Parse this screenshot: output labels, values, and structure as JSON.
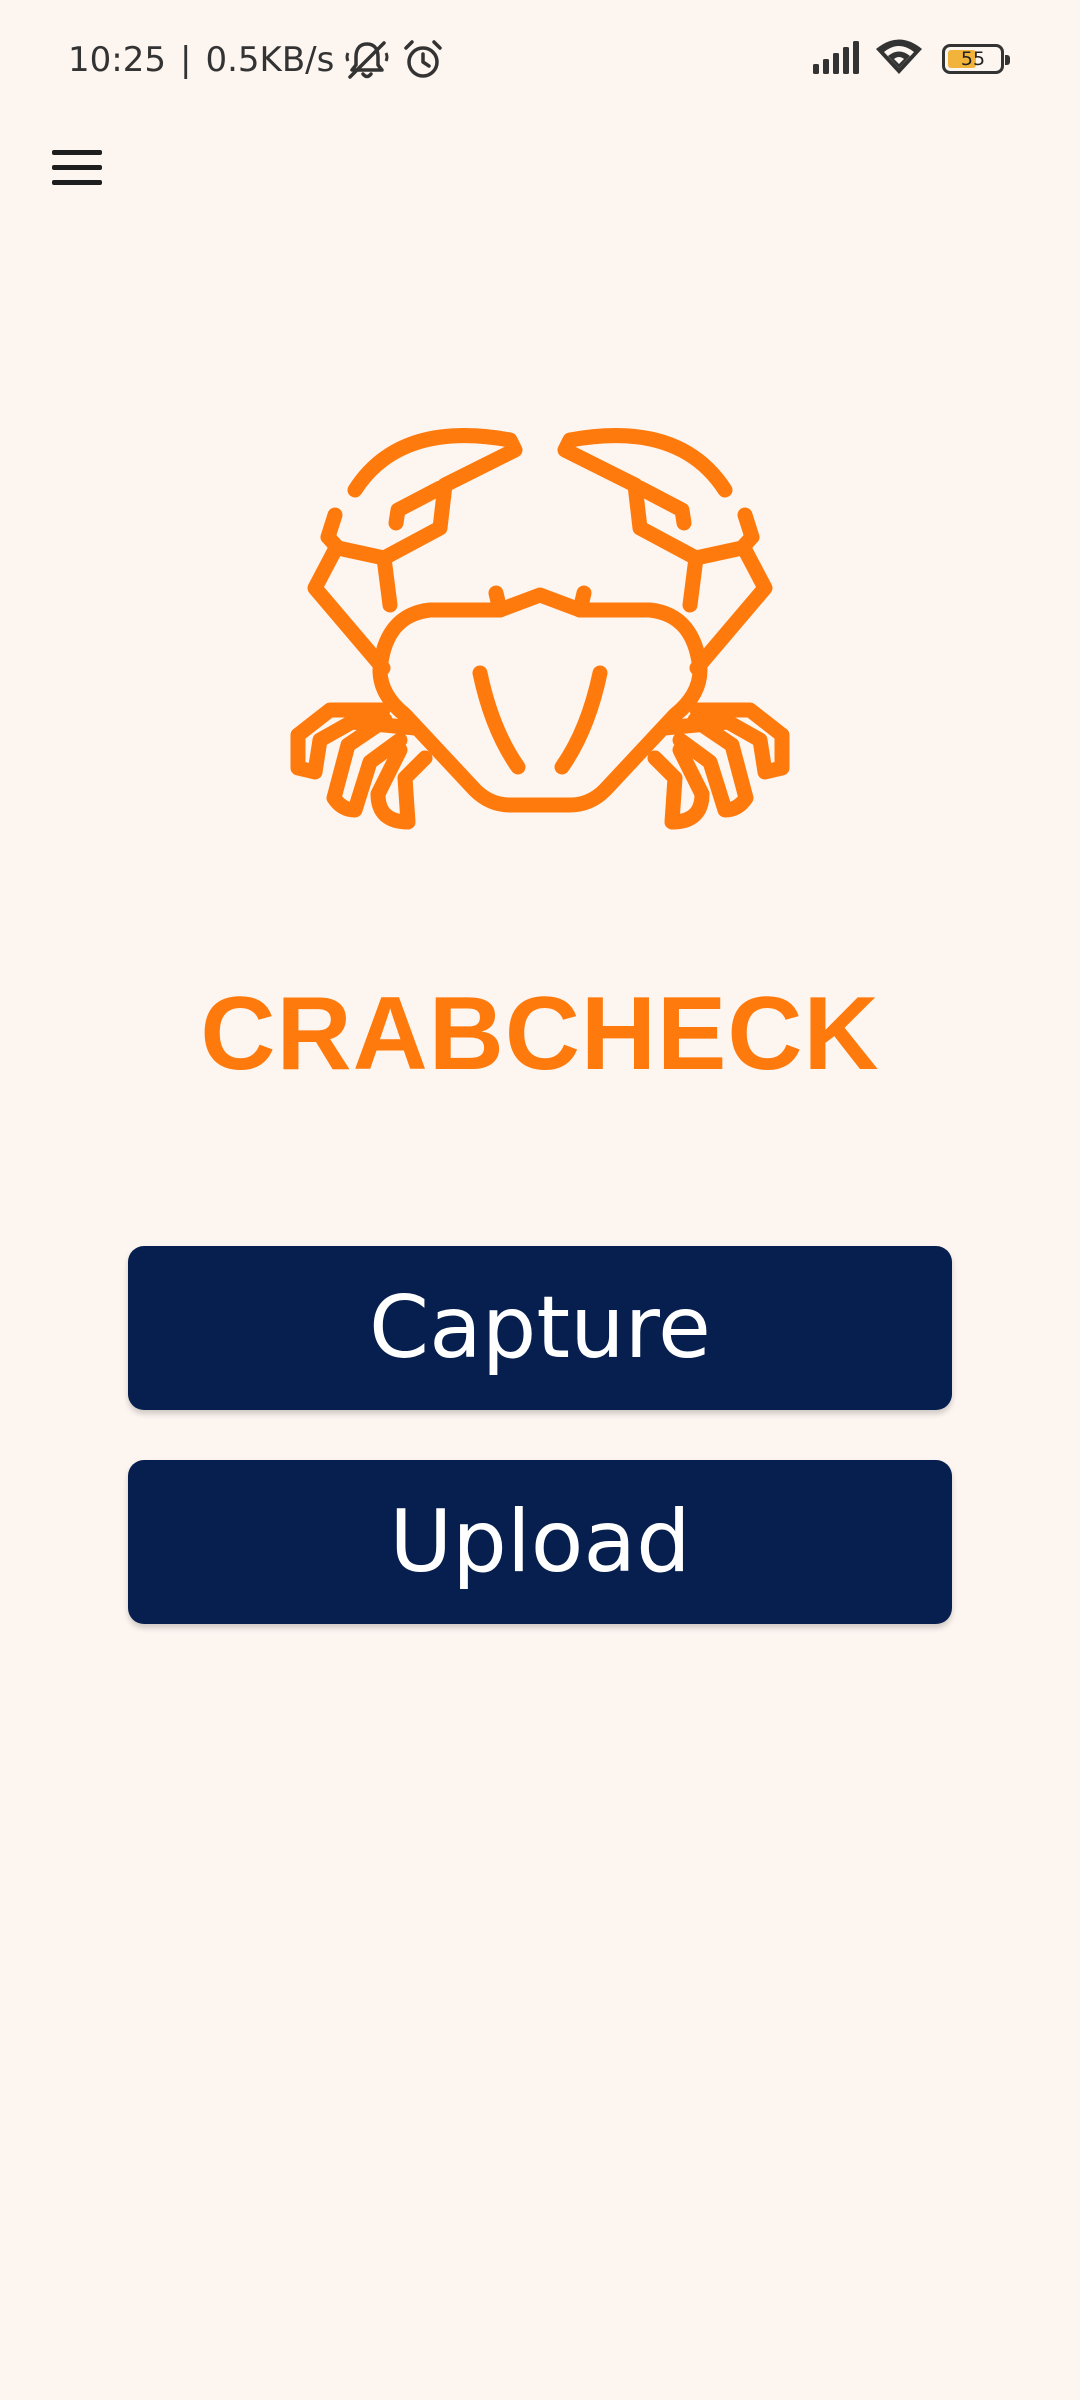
{
  "status_bar": {
    "time": "10:25",
    "separator": "|",
    "network_speed": "0.5KB/s",
    "icons": [
      "mute-icon",
      "alarm-icon",
      "signal-icon",
      "wifi-icon",
      "battery-icon"
    ],
    "battery_level": "55",
    "battery_fill_fraction": 0.55,
    "battery_color": "#f2b33a"
  },
  "header": {
    "menu_icon": "hamburger-menu-icon"
  },
  "logo": {
    "icon": "crab-icon",
    "color": "#ff7a0d"
  },
  "app": {
    "title": "CRABCHECK"
  },
  "actions": {
    "capture_label": "Capture",
    "upload_label": "Upload",
    "button_color": "#071f4f"
  }
}
